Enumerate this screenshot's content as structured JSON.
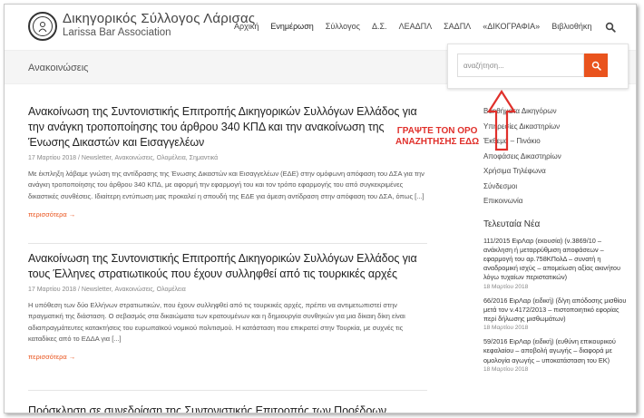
{
  "header": {
    "brand_gr": "Δικηγορικός Σύλλογος Λάρισας",
    "brand_en": "Larissa Bar Association",
    "nav": [
      "Αρχική",
      "Ενημέρωση",
      "Σύλλογος",
      "Δ.Σ.",
      "ΛΕΑΔΠΛ",
      "ΣΑΔΠΛ",
      "«ΔΙΚΟΓΡΑΦΙΑ»",
      "Βιβλιοθήκη"
    ],
    "active_nav": "Ενημέρωση"
  },
  "page": {
    "title": "Ανακοινώσεις"
  },
  "search": {
    "placeholder": "αναζήτηση...",
    "accent": "#e9531d"
  },
  "posts": [
    {
      "title": "Ανακοίνωση της Συντονιστικής Επιτροπής Δικηγορικών Συλλόγων Ελλάδος για την ανάγκη τροποποίησης του άρθρου 340 ΚΠΔ και την ανακοίνωση της Ένωσης Δικαστών και Εισαγγελέων",
      "meta": "17 Μαρτίου 2018  /  Newsletter, Ανακοινώσεις, Ολομέλεια, Σημαντικά",
      "excerpt": "Με έκπληξη λάβαμε γνώση της αντίδρασης της Ένωσης Δικαστών και Εισαγγελέων (ΕΔΕ) στην ομόφωνη απόφαση του ΔΣΑ για την ανάγκη τροποποίησης του άρθρου 340 ΚΠΔ, με αφορμή την εφαρμογή του και τον τρόπο εφαρμογής του από συγκεκριμένες δικαστικές συνθέσεις. Ιδιαίτερη εντύπωση μας προκαλεί η σπουδή της ΕΔΕ για άμεση αντίδραση στην απόφαση του ΔΣΑ, όπως [...]",
      "more": "περισσότερα →"
    },
    {
      "title": "Ανακοίνωση της Συντονιστικής Επιτροπής Δικηγορικών Συλλόγων Ελλάδος για τους Έλληνες στρατιωτικούς που έχουν συλληφθεί από τις τουρκικές αρχές",
      "meta": "17 Μαρτίου 2018  /  Newsletter, Ανακοινώσεις, Ολομέλεια",
      "excerpt": "Η υπόθεση των δύο Ελλήνων στρατιωτικών, που έχουν συλληφθεί από τις τουρκικές αρχές, πρέπει να αντιμετωπιστεί στην πραγματική της διάσταση. Ο σεβασμός στα δικαιώματα των κρατουμένων και η δημιουργία συνθηκών για μια δίκαιη δίκη είναι αδιαπραγμάτευτες κατακτήσεις του ευρωπαϊκού νομικού πολιτισμού. Η κατάσταση που επικρατεί στην Τουρκία, με συχνές τις καταδίκες από το ΕΔΔΑ για [...]",
      "more": "περισσότερα →"
    },
    {
      "title": "Πρόσκληση σε συνεδρίαση της Συντονιστικής Επιτροπής των Προέδρων"
    }
  ],
  "sidebar": {
    "links": [
      "Βοηθήματα Δικηγόρων",
      "Υπηρεσίες Δικαστηρίων",
      "Έκθεμα – Πινάκιο",
      "Αποφάσεις Δικαστηρίων",
      "Χρήσιμα Τηλέφωνα",
      "Σύνδεσμοι",
      "Επικοινωνία"
    ],
    "news_heading": "Τελευταία Νέα",
    "news": [
      {
        "text": "111/2015 ΕιρΛαρ (εκουσία) (ν.3869/10 – ανάκληση ή μεταρρύθμιση αποφάσεων – εφαρμογή του αρ.758ΚΠολΔ – συνατή η αναδρομική ισχύς – απομείωση αξίας ακινήτου λόγω τυχαίων περιστατικών)",
        "date": "18 Μαρτίου 2018"
      },
      {
        "text": "66/2016 ΕιρΛαρ (ειδική) (δ/γη απόδοσης μισθίου μετά τον ν.4172/2013 – πιστοποιητικό εφορίας περί δήλωσης μισθωμάτων)",
        "date": "18 Μαρτίου 2018"
      },
      {
        "text": "59/2016 ΕιρΛαρ (ειδική) (ευθύνη επικουρικού κεφαλαίου – αποβολή αγωγής – διαφορά με ομολογία αγωγής – υποκατάσταση του ΕΚ)",
        "date": "18 Μαρτίου 2018"
      }
    ]
  },
  "annotation": {
    "line1": "ΓΡΑΨΤΕ ΤΟΝ ΟΡΟ",
    "line2": "ΑΝΑΖΗΤΗΣΗΣ ΕΔΩ",
    "color": "#e0302b"
  }
}
